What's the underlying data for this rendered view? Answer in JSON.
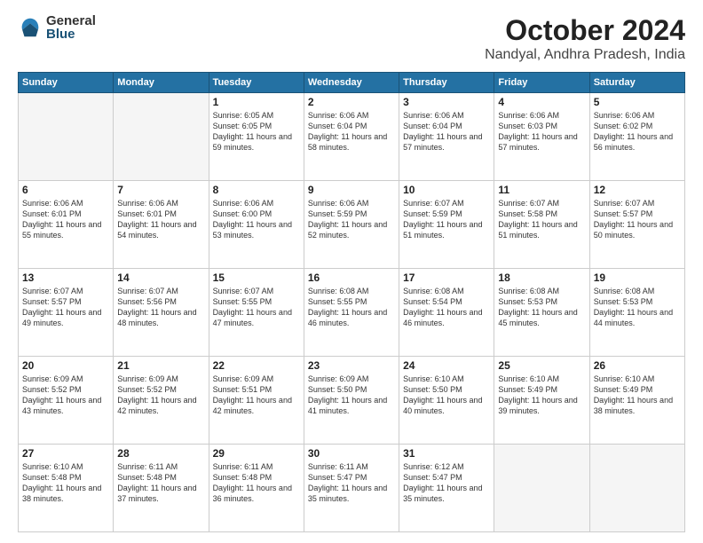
{
  "header": {
    "logo_general": "General",
    "logo_blue": "Blue",
    "month": "October 2024",
    "location": "Nandyal, Andhra Pradesh, India"
  },
  "weekdays": [
    "Sunday",
    "Monday",
    "Tuesday",
    "Wednesday",
    "Thursday",
    "Friday",
    "Saturday"
  ],
  "weeks": [
    [
      {
        "day": "",
        "text": ""
      },
      {
        "day": "",
        "text": ""
      },
      {
        "day": "1",
        "text": "Sunrise: 6:05 AM\nSunset: 6:05 PM\nDaylight: 11 hours and 59 minutes."
      },
      {
        "day": "2",
        "text": "Sunrise: 6:06 AM\nSunset: 6:04 PM\nDaylight: 11 hours and 58 minutes."
      },
      {
        "day": "3",
        "text": "Sunrise: 6:06 AM\nSunset: 6:04 PM\nDaylight: 11 hours and 57 minutes."
      },
      {
        "day": "4",
        "text": "Sunrise: 6:06 AM\nSunset: 6:03 PM\nDaylight: 11 hours and 57 minutes."
      },
      {
        "day": "5",
        "text": "Sunrise: 6:06 AM\nSunset: 6:02 PM\nDaylight: 11 hours and 56 minutes."
      }
    ],
    [
      {
        "day": "6",
        "text": "Sunrise: 6:06 AM\nSunset: 6:01 PM\nDaylight: 11 hours and 55 minutes."
      },
      {
        "day": "7",
        "text": "Sunrise: 6:06 AM\nSunset: 6:01 PM\nDaylight: 11 hours and 54 minutes."
      },
      {
        "day": "8",
        "text": "Sunrise: 6:06 AM\nSunset: 6:00 PM\nDaylight: 11 hours and 53 minutes."
      },
      {
        "day": "9",
        "text": "Sunrise: 6:06 AM\nSunset: 5:59 PM\nDaylight: 11 hours and 52 minutes."
      },
      {
        "day": "10",
        "text": "Sunrise: 6:07 AM\nSunset: 5:59 PM\nDaylight: 11 hours and 51 minutes."
      },
      {
        "day": "11",
        "text": "Sunrise: 6:07 AM\nSunset: 5:58 PM\nDaylight: 11 hours and 51 minutes."
      },
      {
        "day": "12",
        "text": "Sunrise: 6:07 AM\nSunset: 5:57 PM\nDaylight: 11 hours and 50 minutes."
      }
    ],
    [
      {
        "day": "13",
        "text": "Sunrise: 6:07 AM\nSunset: 5:57 PM\nDaylight: 11 hours and 49 minutes."
      },
      {
        "day": "14",
        "text": "Sunrise: 6:07 AM\nSunset: 5:56 PM\nDaylight: 11 hours and 48 minutes."
      },
      {
        "day": "15",
        "text": "Sunrise: 6:07 AM\nSunset: 5:55 PM\nDaylight: 11 hours and 47 minutes."
      },
      {
        "day": "16",
        "text": "Sunrise: 6:08 AM\nSunset: 5:55 PM\nDaylight: 11 hours and 46 minutes."
      },
      {
        "day": "17",
        "text": "Sunrise: 6:08 AM\nSunset: 5:54 PM\nDaylight: 11 hours and 46 minutes."
      },
      {
        "day": "18",
        "text": "Sunrise: 6:08 AM\nSunset: 5:53 PM\nDaylight: 11 hours and 45 minutes."
      },
      {
        "day": "19",
        "text": "Sunrise: 6:08 AM\nSunset: 5:53 PM\nDaylight: 11 hours and 44 minutes."
      }
    ],
    [
      {
        "day": "20",
        "text": "Sunrise: 6:09 AM\nSunset: 5:52 PM\nDaylight: 11 hours and 43 minutes."
      },
      {
        "day": "21",
        "text": "Sunrise: 6:09 AM\nSunset: 5:52 PM\nDaylight: 11 hours and 42 minutes."
      },
      {
        "day": "22",
        "text": "Sunrise: 6:09 AM\nSunset: 5:51 PM\nDaylight: 11 hours and 42 minutes."
      },
      {
        "day": "23",
        "text": "Sunrise: 6:09 AM\nSunset: 5:50 PM\nDaylight: 11 hours and 41 minutes."
      },
      {
        "day": "24",
        "text": "Sunrise: 6:10 AM\nSunset: 5:50 PM\nDaylight: 11 hours and 40 minutes."
      },
      {
        "day": "25",
        "text": "Sunrise: 6:10 AM\nSunset: 5:49 PM\nDaylight: 11 hours and 39 minutes."
      },
      {
        "day": "26",
        "text": "Sunrise: 6:10 AM\nSunset: 5:49 PM\nDaylight: 11 hours and 38 minutes."
      }
    ],
    [
      {
        "day": "27",
        "text": "Sunrise: 6:10 AM\nSunset: 5:48 PM\nDaylight: 11 hours and 38 minutes."
      },
      {
        "day": "28",
        "text": "Sunrise: 6:11 AM\nSunset: 5:48 PM\nDaylight: 11 hours and 37 minutes."
      },
      {
        "day": "29",
        "text": "Sunrise: 6:11 AM\nSunset: 5:48 PM\nDaylight: 11 hours and 36 minutes."
      },
      {
        "day": "30",
        "text": "Sunrise: 6:11 AM\nSunset: 5:47 PM\nDaylight: 11 hours and 35 minutes."
      },
      {
        "day": "31",
        "text": "Sunrise: 6:12 AM\nSunset: 5:47 PM\nDaylight: 11 hours and 35 minutes."
      },
      {
        "day": "",
        "text": ""
      },
      {
        "day": "",
        "text": ""
      }
    ]
  ]
}
